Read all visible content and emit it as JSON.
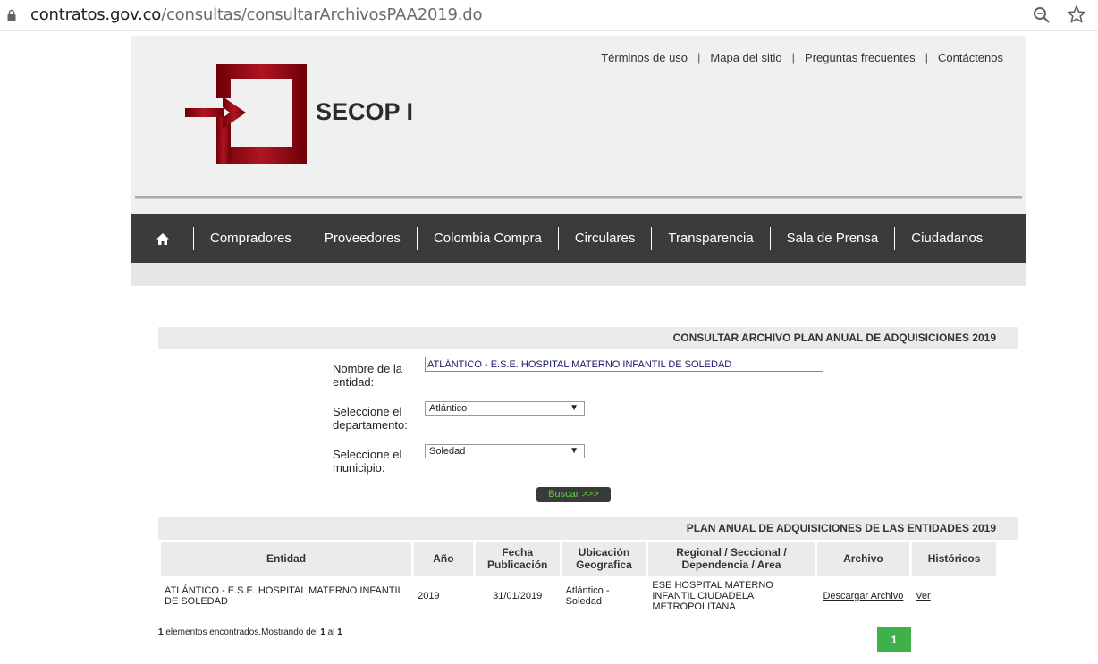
{
  "browser": {
    "url_host": "contratos.gov.co",
    "url_path": "/consultas/consultarArchivosPAA2019.do"
  },
  "header": {
    "links": [
      "Términos de uso",
      "Mapa del sitio",
      "Preguntas frecuentes",
      "Contáctenos"
    ],
    "brand": "SECOP I"
  },
  "nav": {
    "items": [
      "Compradores",
      "Proveedores",
      "Colombia Compra",
      "Circulares",
      "Transparencia",
      "Sala de Prensa",
      "Ciudadanos"
    ]
  },
  "search": {
    "title": "CONSULTAR ARCHIVO PLAN ANUAL DE ADQUISICIONES 2019",
    "entity_label": "Nombre de la entidad:",
    "entity_value": "ATLÁNTICO - E.S.E. HOSPITAL MATERNO INFANTIL DE SOLEDAD",
    "dept_label": "Seleccione el departamento:",
    "dept_value": "Atlántico",
    "muni_label": "Seleccione el municipio:",
    "muni_value": "Soledad",
    "button": "Buscar >>>"
  },
  "results": {
    "title": "PLAN ANUAL DE ADQUISICIONES DE LAS ENTIDADES 2019",
    "columns": [
      "Entidad",
      "Año",
      "Fecha Publicación",
      "Ubicación Geografica",
      "Regional / Seccional / Dependencia / Area",
      "Archivo",
      "Históricos"
    ],
    "rows": [
      {
        "entidad": "ATLÁNTICO - E.S.E. HOSPITAL MATERNO INFANTIL DE SOLEDAD",
        "anio": "2019",
        "fecha": "31/01/2019",
        "ubicacion": "Atlántico - Soledad",
        "regional": "ESE HOSPITAL MATERNO INFANTIL CIUDADELA METROPOLITANA",
        "archivo": "Descargar Archivo",
        "historicos": "Ver"
      }
    ],
    "found_count": "1",
    "found_text": " elementos encontrados.Mostrando del ",
    "from": "1",
    "to_text": " al ",
    "to": "1",
    "page": "1"
  },
  "colors": {
    "nav_bg": "#3b3b3b",
    "logo_red": "#8b0a12",
    "pager_green": "#3fb04a",
    "button_text_green": "#5fd03a"
  }
}
